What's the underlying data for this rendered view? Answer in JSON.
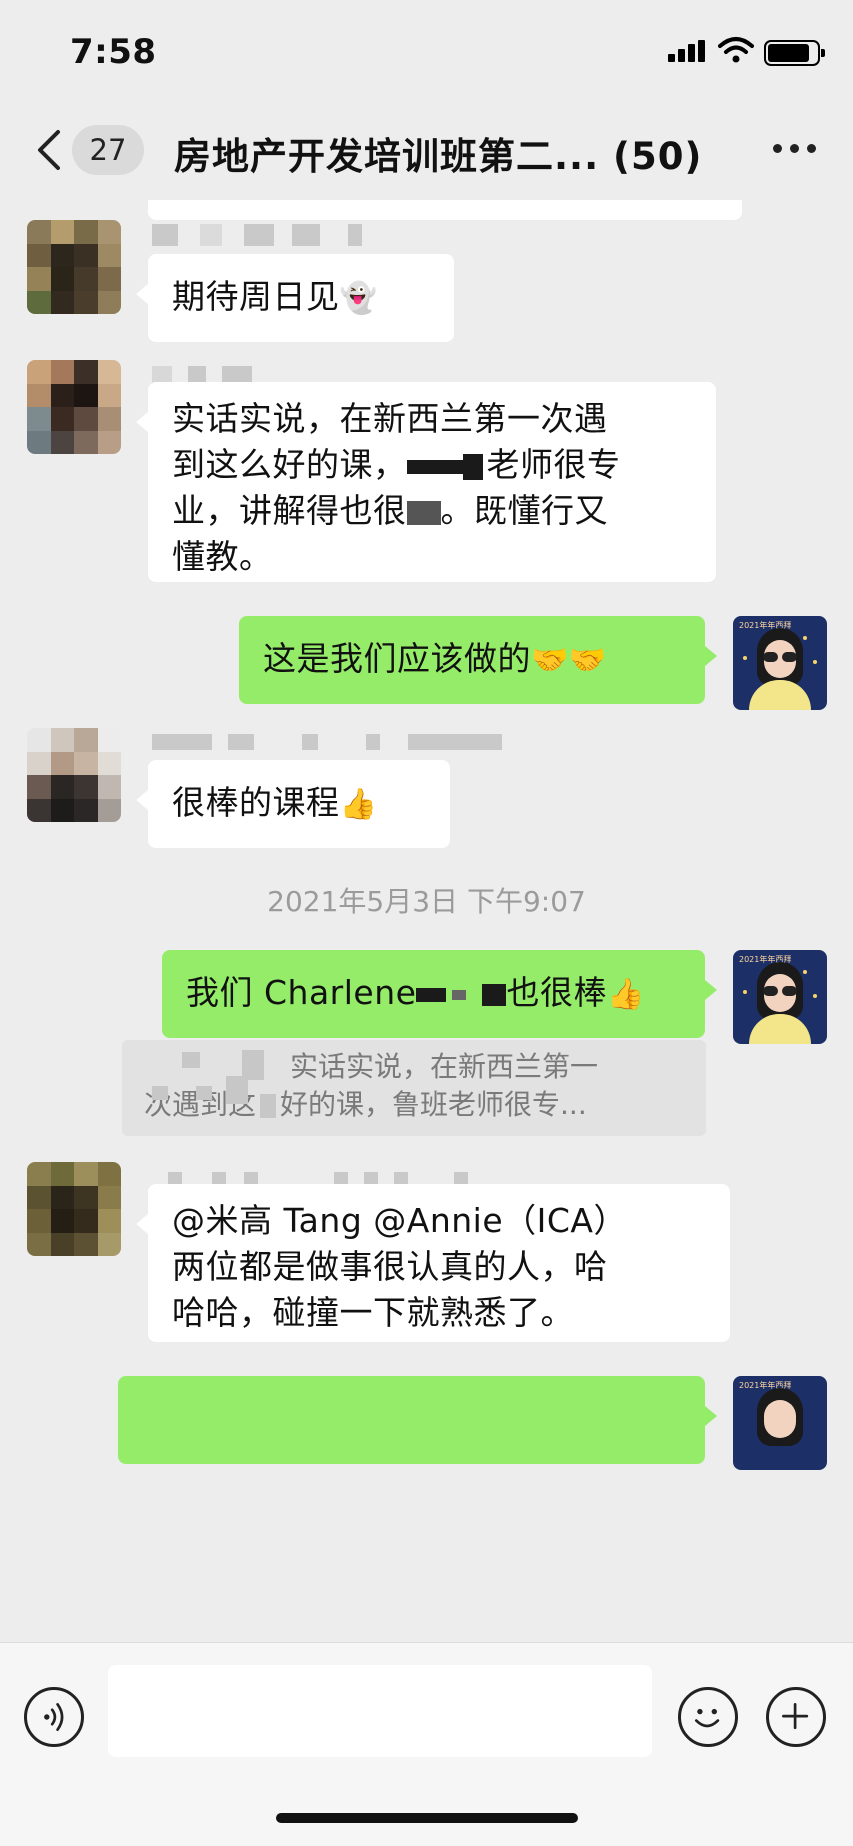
{
  "status_bar": {
    "time": "7:58"
  },
  "header": {
    "unread_count": "27",
    "title": "房地产开发培训班第二... (50)"
  },
  "messages": [
    {
      "direction": "in",
      "text": "期待周日见",
      "emoji": "👻"
    },
    {
      "direction": "in",
      "text_parts": [
        "实话实说，在新西兰第一次遇",
        "到这么好的课，",
        "老师很专",
        "业，讲解得也很",
        "。既懂行又",
        "懂教。"
      ]
    },
    {
      "direction": "out",
      "text": "这是我们应该做的",
      "emoji": "🤝🤝"
    },
    {
      "direction": "in",
      "text": "很棒的课程",
      "emoji": "👍"
    },
    {
      "type": "timestamp",
      "text": "2021年5月3日 下午9:07"
    },
    {
      "direction": "out",
      "text_prefix": "我们 Charlene",
      "text_suffix": "也很棒",
      "emoji": "👍"
    },
    {
      "type": "quote",
      "line1": "实话实说，在新西兰第一",
      "line2": "次遇到这",
      "line2_rest": "好的课，鲁班老师很专..."
    },
    {
      "direction": "in",
      "lines": [
        "@米高 Tang @Annie（ICA）",
        "两位都是做事很认真的人，哈",
        "哈哈，碰撞一下就熟悉了。"
      ]
    }
  ],
  "avatar_caption": "2021年年西拜",
  "colors": {
    "incoming_bubble": "#ffffff",
    "outgoing_bubble": "#95ec69",
    "background": "#ededed"
  },
  "icons": [
    "back-chevron-icon",
    "more-dots-icon",
    "voice-icon",
    "emoji-icon",
    "plus-icon"
  ]
}
